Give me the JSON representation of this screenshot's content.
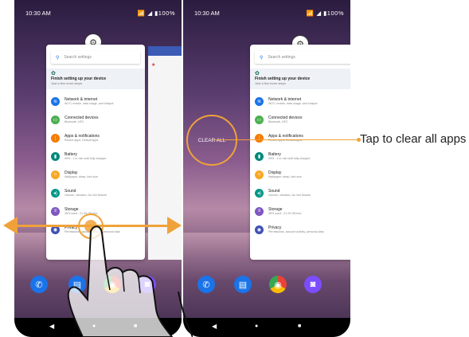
{
  "status": {
    "time": "10:30 AM",
    "icons": "📶 ◢ ▮100%"
  },
  "settings": {
    "search_placeholder": "Search settings",
    "finish_title": "Finish setting up your device",
    "finish_subtitle": "Just a few more steps",
    "items": [
      {
        "title": "Network & internet",
        "subtitle": "Wi-Fi, mobile, data usage, and hotspot",
        "color": "#1a73e8",
        "icon": "wifi-icon",
        "glyph": "≋"
      },
      {
        "title": "Connected devices",
        "subtitle": "Bluetooth, NFC",
        "color": "#4caf50",
        "icon": "devices-icon",
        "glyph": "▭"
      },
      {
        "title": "Apps & notifications",
        "subtitle": "Recent apps, Default apps",
        "color": "#f57c00",
        "icon": "apps-icon",
        "glyph": "⋮"
      },
      {
        "title": "Battery",
        "subtitle": "99% - 1 hr min until fully charged",
        "color": "#00897b",
        "icon": "battery-icon",
        "glyph": "▮"
      },
      {
        "title": "Display",
        "subtitle": "Wallpaper, sleep, font size",
        "color": "#f9a825",
        "icon": "display-icon",
        "glyph": "☼"
      },
      {
        "title": "Sound",
        "subtitle": "Volume, vibration, Do Not Disturb",
        "color": "#009688",
        "icon": "sound-icon",
        "glyph": "◂)"
      },
      {
        "title": "Storage",
        "subtitle": "35% used - 21.29 GB free",
        "color": "#7e57c2",
        "icon": "storage-icon",
        "glyph": "≡"
      },
      {
        "title": "Privacy",
        "subtitle": "Permissions, account activity, personal data",
        "color": "#3f51b5",
        "icon": "privacy-icon",
        "glyph": "◉"
      }
    ]
  },
  "clear_all_label": "CLEAR ALL",
  "callout_text": "Tap to clear all apps",
  "dock": [
    {
      "name": "phone-app-icon",
      "color": "#1a73e8",
      "glyph": "✆"
    },
    {
      "name": "messages-app-icon",
      "color": "#1a73e8",
      "glyph": "▤"
    },
    {
      "name": "chrome-app-icon",
      "color": "#e0e0e0",
      "glyph": "◉"
    },
    {
      "name": "camera-app-icon",
      "color": "#7c4dff",
      "glyph": "◙"
    }
  ],
  "nav": {
    "back": "◀",
    "home": "●",
    "recents": "■"
  },
  "accent_color": "#f0a23a"
}
